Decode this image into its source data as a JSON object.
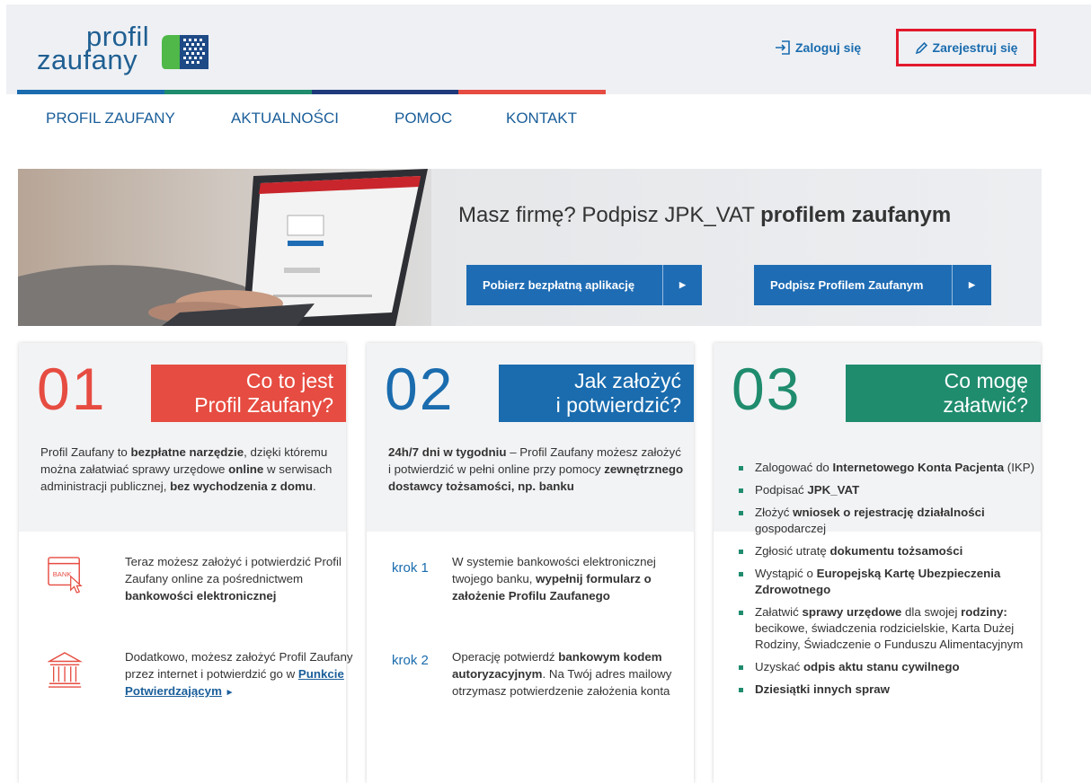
{
  "header": {
    "logo_line1": "profil",
    "logo_line2": "zaufany",
    "login_label": "Zaloguj się",
    "register_label": "Zarejestruj się"
  },
  "nav": [
    "PROFIL ZAUFANY",
    "AKTUALNOŚCI",
    "POMOC",
    "KONTAKT"
  ],
  "hero": {
    "title_plain": "Masz firmę? Podpisz JPK_VAT ",
    "title_bold": "profilem zaufanym",
    "btn_download": "Pobierz bezpłatną aplikację",
    "btn_sign": "Podpisz Profilem Zaufanym"
  },
  "card1": {
    "number": "01",
    "tag_line1": "Co to jest",
    "tag_line2": "Profil Zaufany?",
    "intro_a": "Profil Zaufany to ",
    "intro_b": "bezpłatne narzędzie",
    "intro_c": ", dzięki któremu można załatwiać sprawy urzędowe ",
    "intro_d": "online",
    "intro_e": " w serwisach administracji publicznej, ",
    "intro_f": "bez wychodzenia z domu",
    "intro_g": ".",
    "bank_badge": "BANK",
    "item1_a": "Teraz możesz założyć i potwierdzić Profil Zaufany online za pośrednictwem ",
    "item1_b": "bankowości elektronicznej",
    "item2_a": "Dodatkowo, możesz założyć Profil Zaufany przez internet i potwierdzić go w ",
    "item2_link": "Punkcie Potwierdzającym",
    "item2_arrow": "►"
  },
  "card2": {
    "number": "02",
    "tag_line1": "Jak założyć",
    "tag_line2": "i potwierdzić?",
    "intro_a": "24h/7 dni w tygodniu",
    "intro_b": " – Profil Zaufany możesz założyć i potwierdzić w pełni online przy pomocy ",
    "intro_c": "zewnętrznego dostawcy tożsamości, np. banku",
    "step1_label": "krok 1",
    "step1_a": "W systemie bankowości elektronicznej twojego banku, ",
    "step1_b": "wypełnij formularz o założenie Profilu Zaufanego",
    "step2_label": "krok 2",
    "step2_a": "Operację potwierdź ",
    "step2_b": "bankowym kodem autoryzacyjnym",
    "step2_c": ". Na Twój adres mailowy otrzymasz potwierdzenie założenia konta"
  },
  "card3": {
    "number": "03",
    "tag_line1": "Co mogę",
    "tag_line2": "załatwić?",
    "items": [
      {
        "a": "Zalogować do ",
        "b": "Internetowego Konta Pacjenta",
        "c": " (IKP)"
      },
      {
        "a": "Podpisać ",
        "b": "JPK_VAT",
        "c": ""
      },
      {
        "a": "Złożyć ",
        "b": "wniosek o rejestrację działalności",
        "c": " gospodarczej"
      },
      {
        "a": "Zgłosić utratę ",
        "b": "dokumentu tożsamości",
        "c": ""
      },
      {
        "a": "Wystąpić o ",
        "b": "Europejską Kartę Ubezpieczenia Zdrowotnego",
        "c": ""
      },
      {
        "a": "Załatwić ",
        "b": "sprawy urzędowe",
        "c": " dla swojej "
      },
      {
        "a": "Uzyskać ",
        "b": "odpis aktu stanu cywilnego",
        "c": ""
      },
      {
        "a": "",
        "b": "Dziesiątki innych spraw",
        "c": ""
      }
    ],
    "item6_d": "rodziny:",
    "item6_e": " becikowe, świadczenia rodzicielskie, Karta Dużej Rodziny, Świadczenie o Funduszu Alimentacyjnym"
  },
  "colors": {
    "blue": "#1a6cae",
    "red": "#e64c41",
    "teal": "#1f8c6e",
    "navy": "#1e3a7b",
    "highlight": "#e3192c"
  }
}
